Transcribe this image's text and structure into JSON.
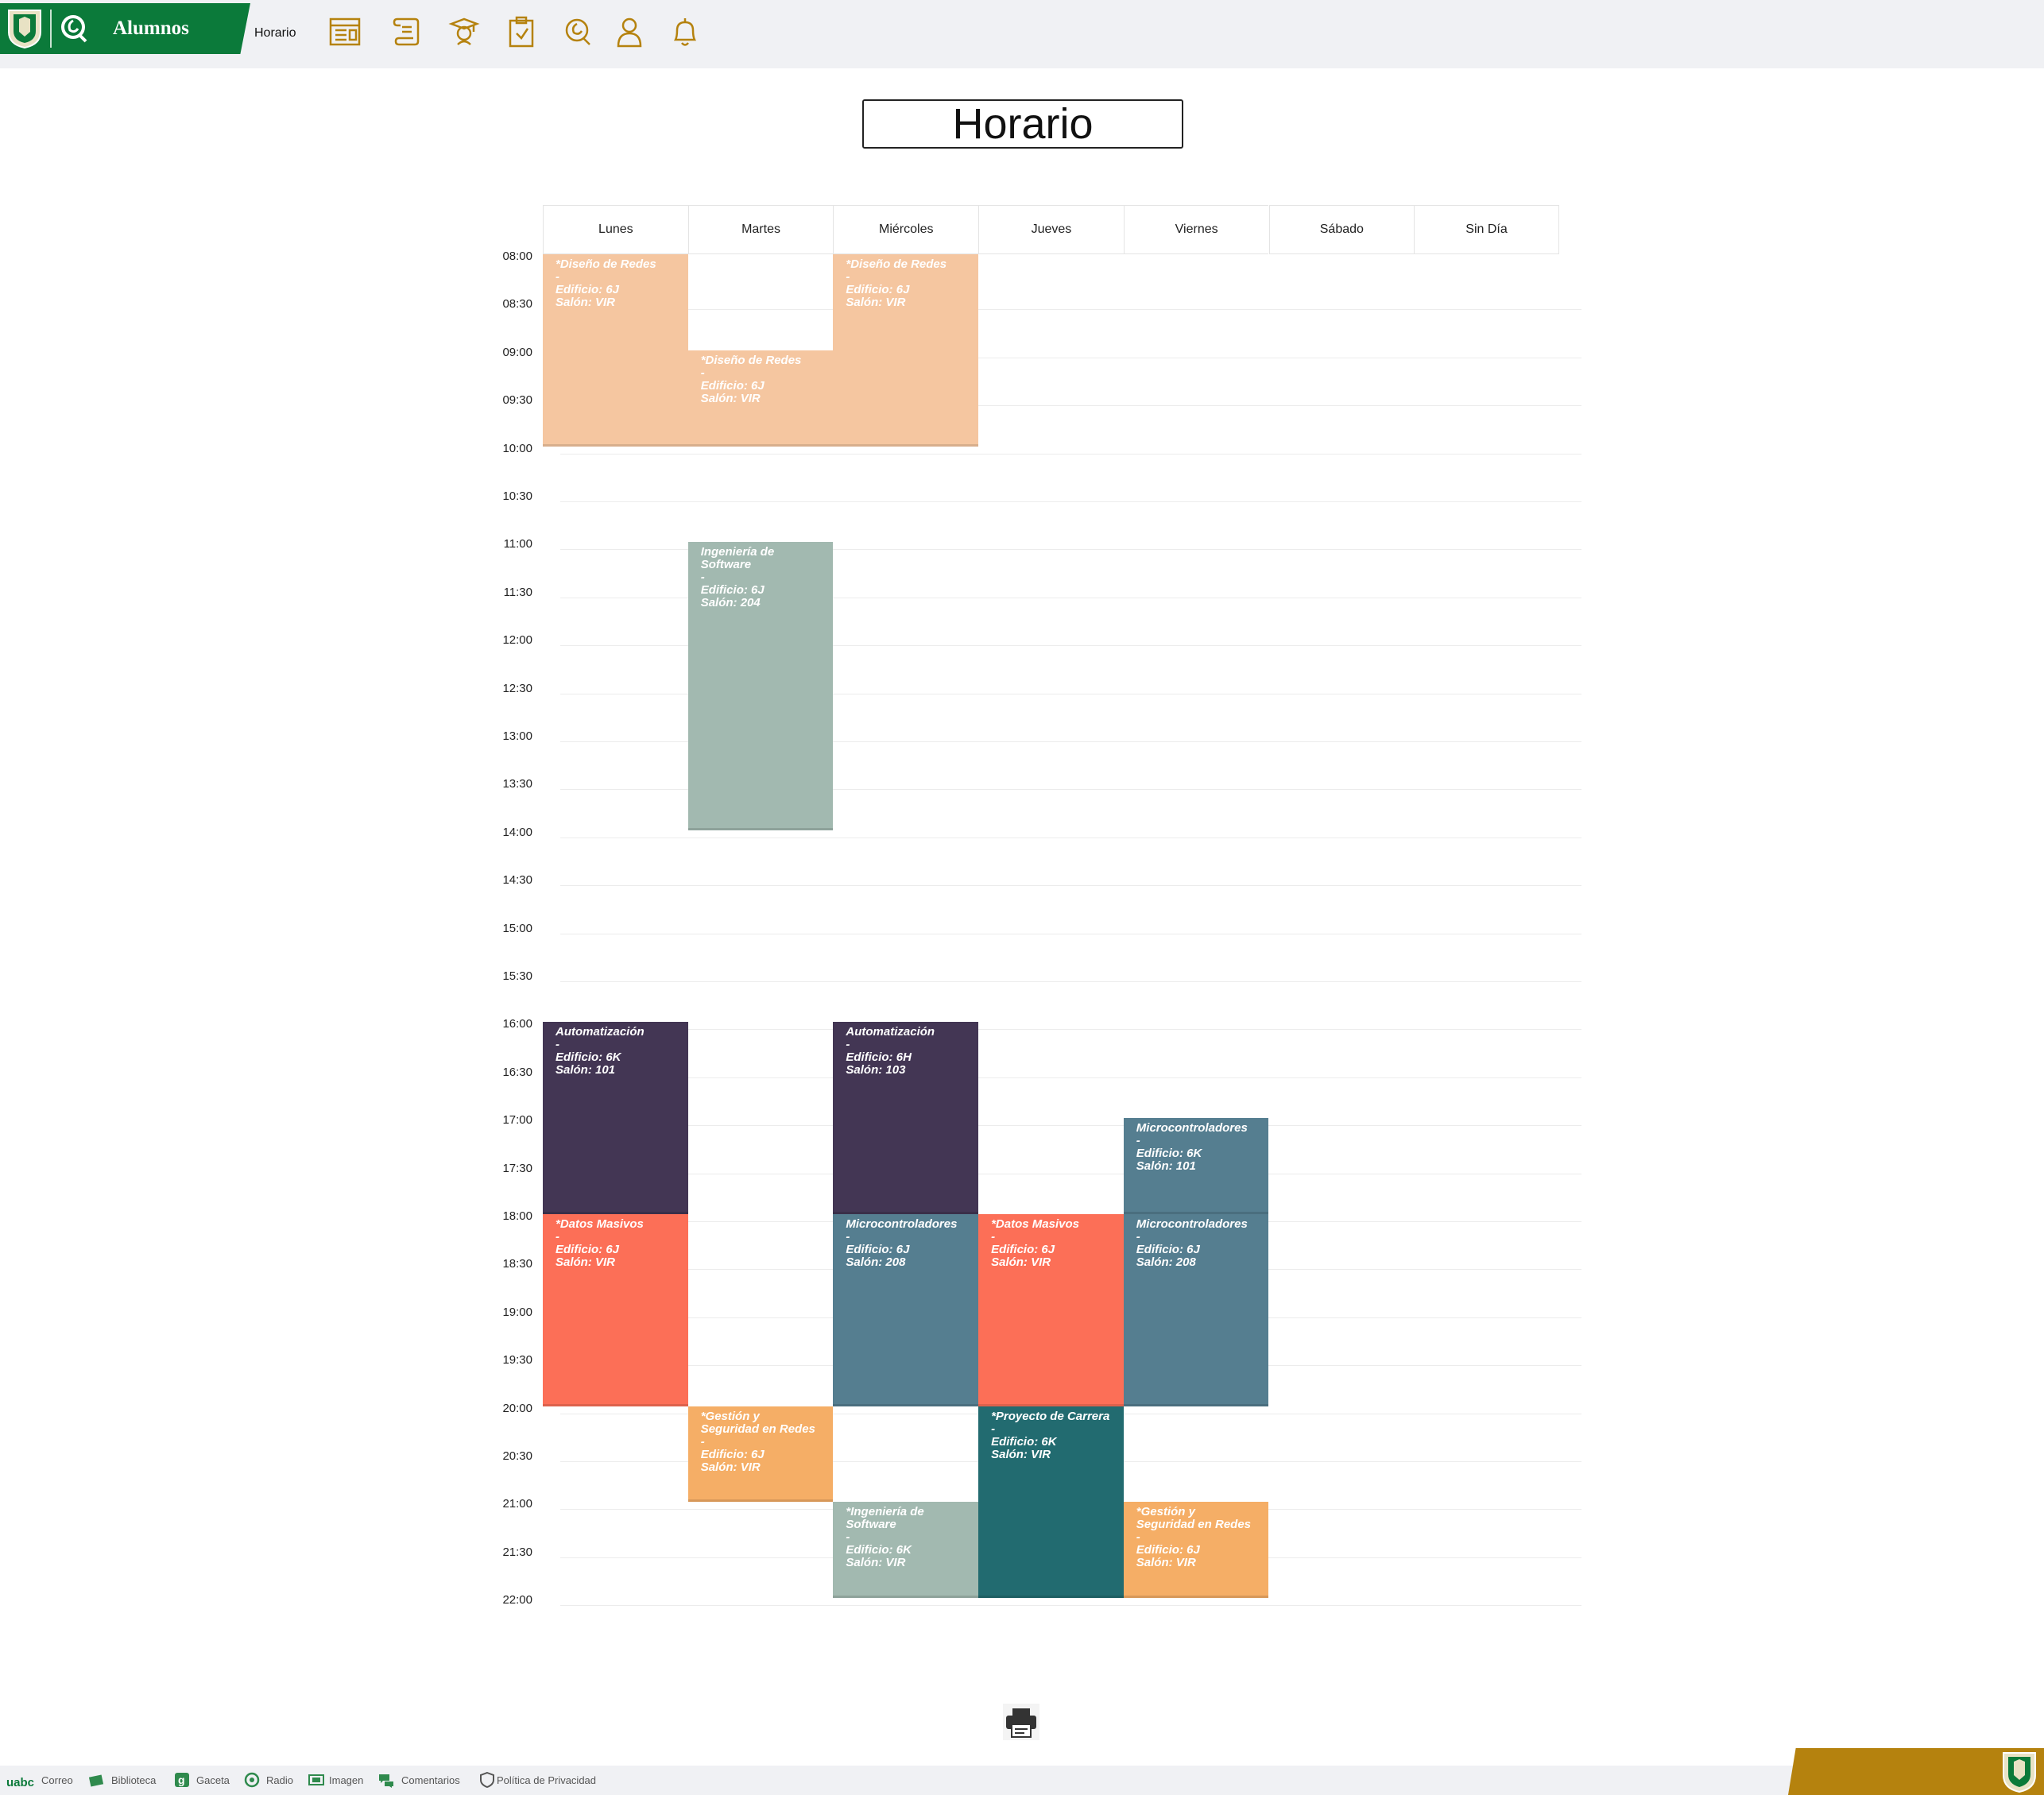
{
  "header": {
    "brand_title": "Alumnos",
    "breadcrumb": "Horario",
    "nav_icons": [
      "schedule-icon",
      "scroll-icon",
      "graduate-icon",
      "clipboard-icon",
      "chat-icon",
      "user-icon",
      "bell-icon"
    ],
    "accent_color": "#0b7a3a",
    "icon_color": "#b5820e"
  },
  "page": {
    "title": "Horario"
  },
  "schedule": {
    "days": [
      "Lunes",
      "Martes",
      "Miércoles",
      "Jueves",
      "Viernes",
      "Sábado",
      "Sin Día"
    ],
    "times": [
      "08:00",
      "08:30",
      "09:00",
      "09:30",
      "10:00",
      "10:30",
      "11:00",
      "11:30",
      "12:00",
      "12:30",
      "13:00",
      "13:30",
      "14:00",
      "14:30",
      "15:00",
      "15:30",
      "16:00",
      "16:30",
      "17:00",
      "17:30",
      "18:00",
      "18:30",
      "19:00",
      "19:30",
      "20:00",
      "20:30",
      "21:00",
      "21:30",
      "22:00"
    ],
    "events": [
      {
        "day": 0,
        "start": "08:00",
        "end": "10:00",
        "title": "*Diseño de Redes",
        "dash": "-",
        "building": "Edificio: 6J",
        "room": "Salón: VIR",
        "color": "#f5c6a0"
      },
      {
        "day": 1,
        "start": "09:00",
        "end": "10:00",
        "title": "*Diseño de Redes",
        "dash": "-",
        "building": "Edificio: 6J",
        "room": "Salón: VIR",
        "color": "#f5c6a0"
      },
      {
        "day": 2,
        "start": "08:00",
        "end": "10:00",
        "title": "*Diseño de Redes",
        "dash": "-",
        "building": "Edificio: 6J",
        "room": "Salón: VIR",
        "color": "#f5c6a0"
      },
      {
        "day": 1,
        "start": "11:00",
        "end": "14:00",
        "title": "Ingeniería de Software",
        "dash": "-",
        "building": "Edificio: 6J",
        "room": "Salón: 204",
        "color": "#a2b9b0"
      },
      {
        "day": 0,
        "start": "16:00",
        "end": "18:00",
        "title": "Automatización",
        "dash": "-",
        "building": "Edificio: 6K",
        "room": "Salón: 101",
        "color": "#433654"
      },
      {
        "day": 2,
        "start": "16:00",
        "end": "18:00",
        "title": "Automatización",
        "dash": "-",
        "building": "Edificio: 6H",
        "room": "Salón: 103",
        "color": "#433654"
      },
      {
        "day": 4,
        "start": "17:00",
        "end": "18:00",
        "title": "Microcontroladores",
        "dash": "-",
        "building": "Edificio: 6K",
        "room": "Salón: 101",
        "color": "#557e90"
      },
      {
        "day": 0,
        "start": "18:00",
        "end": "20:00",
        "title": "*Datos Masivos",
        "dash": "-",
        "building": "Edificio: 6J",
        "room": "Salón: VIR",
        "color": "#fc6f57"
      },
      {
        "day": 2,
        "start": "18:00",
        "end": "20:00",
        "title": "Microcontroladores",
        "dash": "-",
        "building": "Edificio: 6J",
        "room": "Salón: 208",
        "color": "#557e90"
      },
      {
        "day": 3,
        "start": "18:00",
        "end": "20:00",
        "title": "*Datos Masivos",
        "dash": "-",
        "building": "Edificio: 6J",
        "room": "Salón: VIR",
        "color": "#fc6f57"
      },
      {
        "day": 4,
        "start": "18:00",
        "end": "20:00",
        "title": "Microcontroladores",
        "dash": "-",
        "building": "Edificio: 6J",
        "room": "Salón: 208",
        "color": "#557e90"
      },
      {
        "day": 1,
        "start": "20:00",
        "end": "21:00",
        "title": "*Gestión y Seguridad en Redes",
        "dash": "-",
        "building": "Edificio: 6J",
        "room": "Salón: VIR",
        "color": "#f5ae66"
      },
      {
        "day": 3,
        "start": "20:00",
        "end": "22:00",
        "title": "*Proyecto de Carrera",
        "dash": "-",
        "building": "Edificio: 6K",
        "room": "Salón: VIR",
        "color": "#226b70"
      },
      {
        "day": 2,
        "start": "21:00",
        "end": "22:00",
        "title": "*Ingeniería de Software",
        "dash": "-",
        "building": "Edificio: 6K",
        "room": "Salón: VIR",
        "color": "#a2b9b0"
      },
      {
        "day": 4,
        "start": "21:00",
        "end": "22:00",
        "title": "*Gestión y Seguridad en Redes",
        "dash": "-",
        "building": "Edificio: 6J",
        "room": "Salón: VIR",
        "color": "#f5ae66"
      }
    ]
  },
  "footer": {
    "links": [
      {
        "label": "Correo",
        "icon": "mail-icon"
      },
      {
        "label": "Biblioteca",
        "icon": "books-icon"
      },
      {
        "label": "Gaceta",
        "icon": "gazette-icon"
      },
      {
        "label": "Radio",
        "icon": "radio-icon"
      },
      {
        "label": "Imagen",
        "icon": "tv-icon"
      },
      {
        "label": "Comentarios",
        "icon": "comments-icon"
      },
      {
        "label": "Política de Privacidad",
        "icon": "shield-icon"
      }
    ],
    "uabc_label": "uabc"
  }
}
